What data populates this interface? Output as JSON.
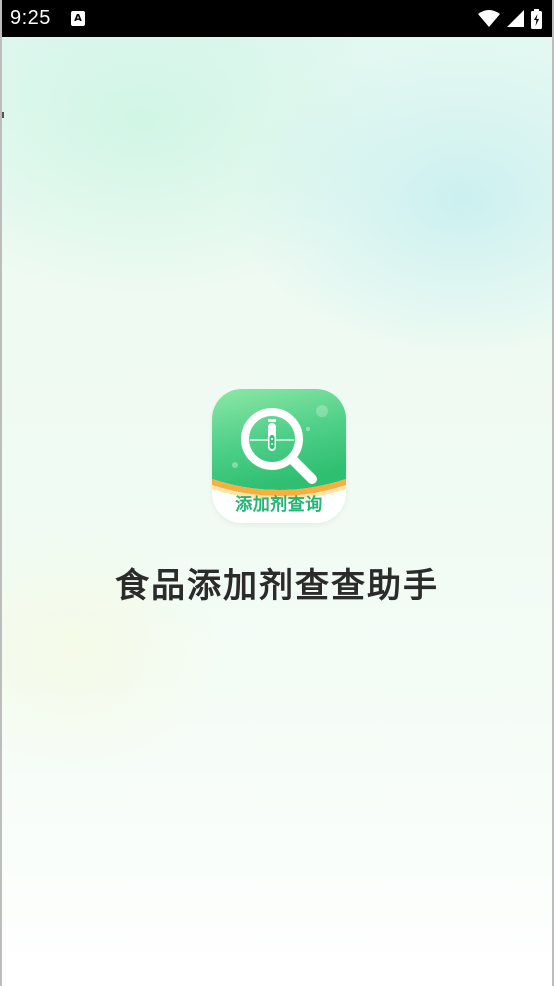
{
  "status_bar": {
    "time": "9:25",
    "notification_icon": "a-letter-icon",
    "wifi_icon": "wifi-icon",
    "signal_icon": "signal-icon",
    "battery_icon": "battery-charging-icon"
  },
  "splash": {
    "icon_label": "添加剂查询",
    "app_name": "食品添加剂查查助手"
  },
  "colors": {
    "brand_green": "#22b573",
    "icon_gradient_top": "#8ee7a6",
    "icon_gradient_bottom": "#2fbf71",
    "accent_orange": "#f5b041",
    "title_text": "#2b2b2b"
  }
}
